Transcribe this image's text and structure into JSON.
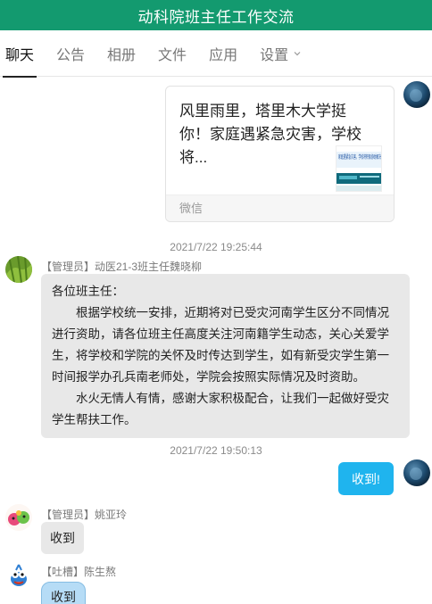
{
  "window": {
    "title": "动科院班主任工作交流"
  },
  "tabs": [
    {
      "label": "聊天",
      "active": true
    },
    {
      "label": "公告"
    },
    {
      "label": "相册"
    },
    {
      "label": "文件"
    },
    {
      "label": "应用"
    },
    {
      "label": "设置"
    }
  ],
  "messages": {
    "shared_card": {
      "text": "风里雨里，塔里木大学挺你！家庭遇紧急灾害，学校将...",
      "thumb_text": "家庭遇紧急灾害，学校将积极协助解决",
      "source": "微信"
    },
    "ts1": "2021/7/22 19:25:44",
    "m1": {
      "sender": "【管理员】动医21-3班主任魏晓柳",
      "line1": "各位班主任：",
      "para1": "根据学校统一安排，近期将对已受灾河南学生区分不同情况进行资助，请各位班主任高度关注河南籍学生动态，关心关爱学生，将学校和学院的关怀及时传达到学生，如有新受灾学生第一时间报学办孔兵南老师处，学院会按照实际情况及时资助。",
      "para2": "水火无情人有情，感谢大家积极配合，让我们一起做好受灾学生帮扶工作。"
    },
    "ts2": "2021/7/22 19:50:13",
    "m2": {
      "text": "收到!"
    },
    "m3": {
      "sender": "【管理员】姚亚玲",
      "text": "收到"
    },
    "m4": {
      "sender": "【吐槽】陈生熬",
      "text": "收到"
    }
  },
  "colors": {
    "titlebar": "#139a6f",
    "self_bubble": "#1fb4ee",
    "other_bubble": "#e8e8e8"
  }
}
